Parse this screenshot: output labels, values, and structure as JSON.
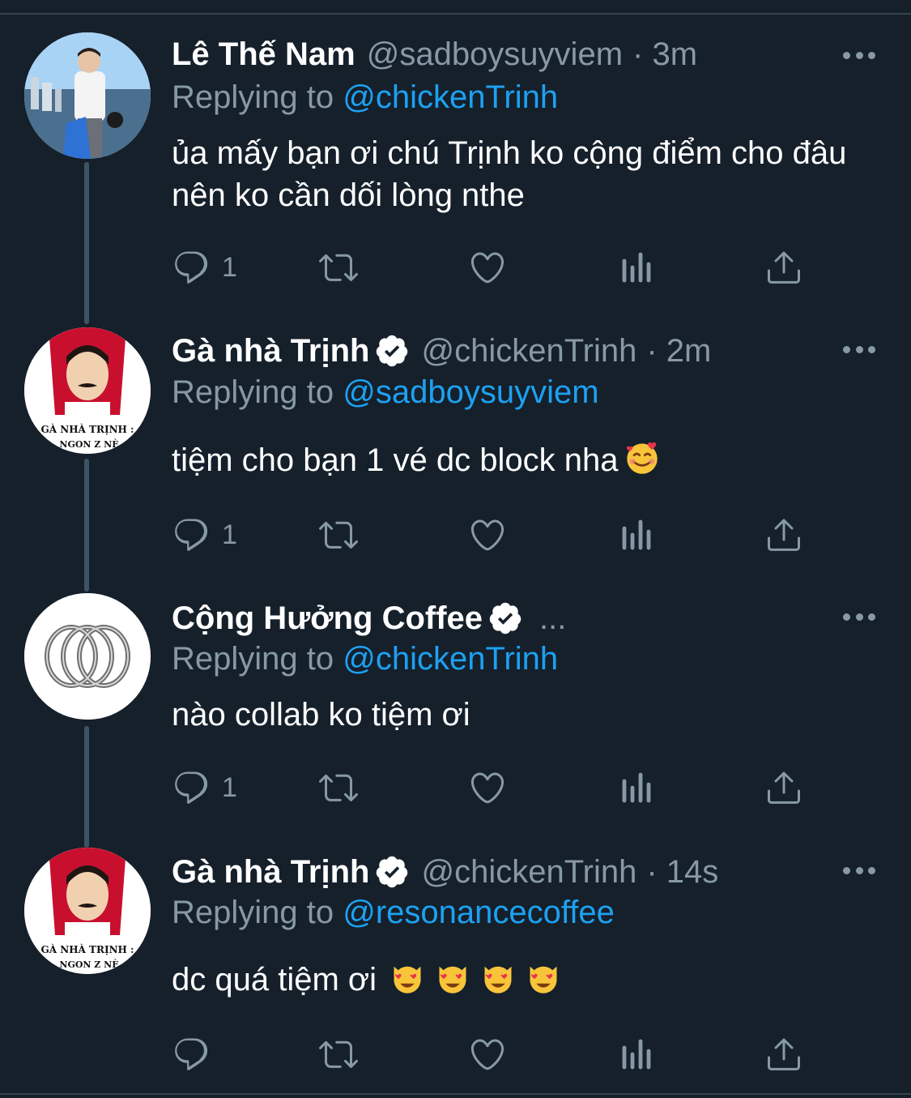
{
  "tweets": [
    {
      "name": "Lê Thế Nam",
      "handle": "@sadboysuyviem",
      "time": "· 3m",
      "verified": false,
      "replying_label": "Replying to",
      "replying_to": "@chickenTrinh",
      "text": "ủa mấy bạn ơi chú Trịnh ko cộng điểm cho đâu nên ko cần dối lòng nthe",
      "reply_count": "1"
    },
    {
      "name": "Gà nhà Trịnh",
      "handle": "@chickenTrinh",
      "time": "· 2m",
      "verified": true,
      "replying_label": "Replying to",
      "replying_to": "@sadboysuyviem",
      "text": "tiệm cho bạn 1 vé dc block nha",
      "reply_count": "1",
      "avatar_caption": "GÀ NHÀ TRỊNH : NGON Z NÈ"
    },
    {
      "name": "Cộng Hưởng Coffee",
      "handle": "...",
      "time": "",
      "verified": true,
      "replying_label": "Replying to",
      "replying_to": "@chickenTrinh",
      "text": "nào collab ko tiệm ơi",
      "reply_count": "1"
    },
    {
      "name": "Gà nhà Trịnh",
      "handle": "@chickenTrinh",
      "time": "· 14s",
      "verified": true,
      "replying_label": "Replying to",
      "replying_to": "@resonancecoffee",
      "text": "dc quá tiệm ơi",
      "reply_count": "",
      "avatar_caption": "GÀ NHÀ TRỊNH : NGON Z NÈ"
    }
  ],
  "icons": {
    "reply": "reply-icon",
    "retweet": "retweet-icon",
    "like": "like-icon",
    "analytics": "analytics-icon",
    "share": "share-icon",
    "more": "more-icon",
    "verified": "verified-badge-icon"
  },
  "colors": {
    "background": "#15202b",
    "muted": "#8899a6",
    "link": "#1da1f2",
    "thread_line": "#3d5466"
  }
}
